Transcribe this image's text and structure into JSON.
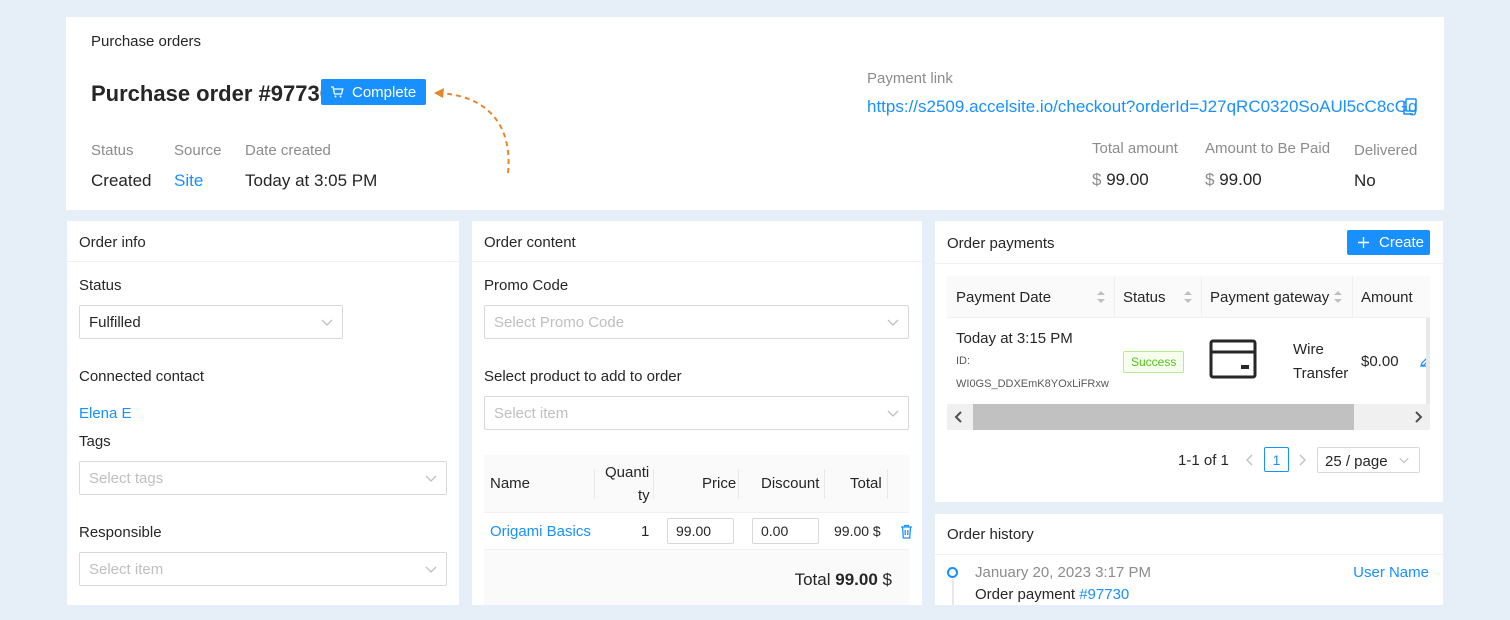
{
  "header": {
    "breadcrumb": "Purchase orders",
    "title": "Purchase order #97730",
    "complete_button": "Complete",
    "status_label": "Status",
    "status_value": "Created",
    "source_label": "Source",
    "source_value": "Site",
    "date_label": "Date created",
    "date_value": "Today at 3:05 PM",
    "payment_link_label": "Payment link",
    "payment_link_url": "https://s2509.accelsite.io/checkout?orderId=J27qRC0320SoAUl5cC8cGg",
    "total_amount_label": "Total amount",
    "total_amount_currency": "$",
    "total_amount_value": "99.00",
    "amount_to_pay_label": "Amount to Be Paid",
    "amount_to_pay_currency": "$",
    "amount_to_pay_value": "99.00",
    "delivered_label": "Delivered",
    "delivered_value": "No",
    "accent_color": "#1890ff",
    "annotation_arrow_color": "#e8862a"
  },
  "order_info": {
    "title": "Order info",
    "status_label": "Status",
    "status_value": "Fulfilled",
    "contact_label": "Connected contact",
    "contact_value": "Elena E",
    "tags_label": "Tags",
    "tags_placeholder": "Select tags",
    "responsible_label": "Responsible",
    "responsible_placeholder": "Select item"
  },
  "order_content": {
    "title": "Order content",
    "promo_label": "Promo Code",
    "promo_placeholder": "Select Promo Code",
    "product_label": "Select product to add to order",
    "product_placeholder": "Select item",
    "columns": {
      "name": "Name",
      "quantity_1": "Quanti",
      "quantity_2": "ty",
      "price": "Price",
      "discount": "Discount",
      "total": "Total"
    },
    "rows": [
      {
        "name": "Origami Basics",
        "quantity": "1",
        "price": "99.00",
        "discount": "0.00",
        "total": "99.00 $"
      }
    ],
    "total_label": "Total",
    "total_value": "99.00",
    "total_currency": "$"
  },
  "order_payments": {
    "title": "Order payments",
    "create_button": "Create",
    "columns": {
      "date": "Payment Date",
      "status": "Status",
      "gateway": "Payment gateway",
      "amount": "Amount"
    },
    "rows": [
      {
        "date": "Today at 3:15 PM",
        "id_label": "ID:",
        "id_value": "WI0GS_DDXEmK8YOxLiFRxw",
        "status": "Success",
        "gateway_1": "Wire",
        "gateway_2": "Transfer",
        "amount": "$0.00"
      }
    ],
    "pagination": {
      "range": "1-1 of 1",
      "current_page": "1",
      "page_size": "25 / page"
    },
    "success_color": "#52c41a"
  },
  "order_history": {
    "title": "Order history",
    "entries": [
      {
        "date": "January 20, 2023 3:17 PM",
        "user": "User Name",
        "text": "Order payment",
        "ref": "#97730"
      }
    ]
  }
}
